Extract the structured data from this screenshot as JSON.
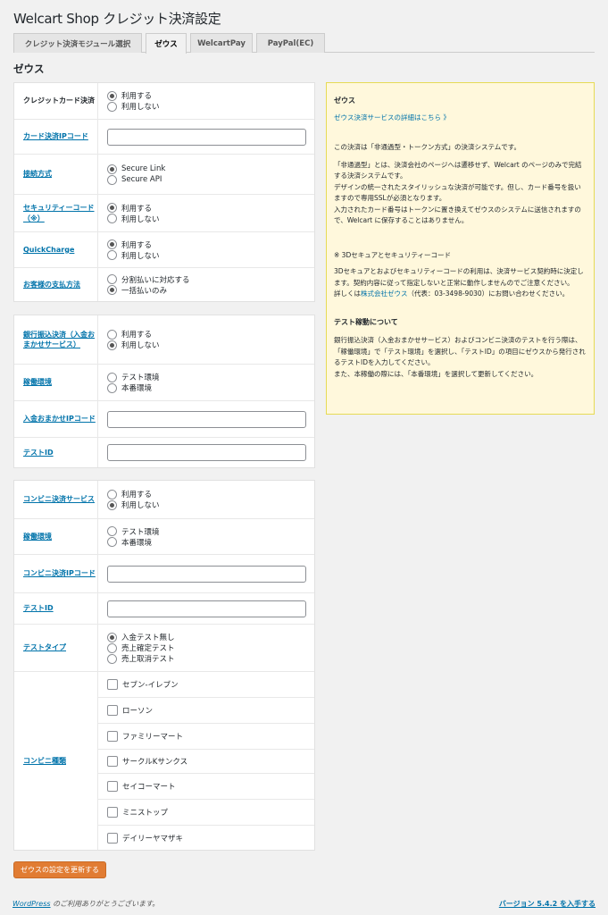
{
  "page_title": "Welcart Shop クレジット決済設定",
  "tabs": [
    "クレジット決済モジュール選択",
    "ゼウス",
    "WelcartPay",
    "PayPal(EC)"
  ],
  "section_title": "ゼウス",
  "card1": {
    "credit": {
      "label": "クレジットカード決済",
      "options": [
        "利用する",
        "利用しない"
      ],
      "selected": 0
    },
    "ip_code": {
      "label": "カード決済IPコード",
      "value": ""
    },
    "connection": {
      "label": "接続方式",
      "options": [
        "Secure Link",
        "Secure API"
      ],
      "selected": 0
    },
    "security": {
      "label": "セキュリティーコード（※）",
      "options": [
        "利用する",
        "利用しない"
      ],
      "selected": 0
    },
    "quickcharge": {
      "label": "QuickCharge",
      "options": [
        "利用する",
        "利用しない"
      ],
      "selected": 0
    },
    "payment_method": {
      "label": "お客様の支払方法",
      "options": [
        "分割払いに対応する",
        "一括払いのみ"
      ],
      "selected": 1
    }
  },
  "card2": {
    "bank": {
      "label": "銀行振込決済（入金おまかせサービス）",
      "options": [
        "利用する",
        "利用しない"
      ],
      "selected": 1
    },
    "env": {
      "label": "稼働環境",
      "options": [
        "テスト環境",
        "本番環境"
      ],
      "selected": -1
    },
    "ip_code": {
      "label": "入金おまかせIPコード",
      "value": ""
    },
    "test_id": {
      "label": "テストID",
      "value": ""
    }
  },
  "card3": {
    "conv": {
      "label": "コンビニ決済サービス",
      "options": [
        "利用する",
        "利用しない"
      ],
      "selected": 1
    },
    "env": {
      "label": "稼働環境",
      "options": [
        "テスト環境",
        "本番環境"
      ],
      "selected": -1
    },
    "ip_code": {
      "label": "コンビニ決済IPコード",
      "value": ""
    },
    "test_id": {
      "label": "テストID",
      "value": ""
    },
    "test_type": {
      "label": "テストタイプ",
      "options": [
        "入金テスト無し",
        "売上確定テスト",
        "売上取消テスト"
      ],
      "selected": 0
    },
    "kinds": {
      "label": "コンビニ種類",
      "stores": [
        "セブン-イレブン",
        "ローソン",
        "ファミリーマート",
        "サークルKサンクス",
        "セイコーマート",
        "ミニストップ",
        "デイリーヤマザキ"
      ]
    }
  },
  "info": {
    "title": "ゼウス",
    "link": "ゼウス決済サービスの詳細はこちら 》",
    "p1": "この決済は「非通過型・トークン方式」の決済システムです。",
    "p2": "「非通過型」とは、決済会社のページへは遷移せず、Welcart のページのみで完結する決済システムです。\nデザインの統一されたスタイリッシュな決済が可能です。但し、カード番号を扱いますので専用SSLが必須となります。\n入力されたカード番号はトークンに置き換えてゼウスのシステムに送信されますので、Welcart に保存することはありません。",
    "note_title": "※ 3Dセキュアとセキュリティーコード",
    "p3": "3Dセキュアとおよびセキュリティーコードの利用は、決済サービス契約時に決定します。契約内容に従って指定しないと正常に動作しませんのでご注意ください。",
    "p4_pre": "詳しくは",
    "p4_link": "株式会社ゼウス",
    "p4_post": "（代表：03-3498-9030）にお問い合わせください。",
    "test_title": "テスト稼動について",
    "p5": "銀行振込決済（入金おまかせサービス）およびコンビニ決済のテストを行う際は、「稼働環境」で「テスト環境」を選択し、「テストID」の項目にゼウスから発行されるテストIDを入力してください。\nまた、本稼働の際には、「本番環境」を選択して更新してください。"
  },
  "submit_label": "ゼウスの設定を更新する",
  "footer": {
    "wp_link": "WordPress",
    "thanks": " のご利用ありがとうございます。",
    "version": "バージョン 5.4.2 を入手する"
  }
}
